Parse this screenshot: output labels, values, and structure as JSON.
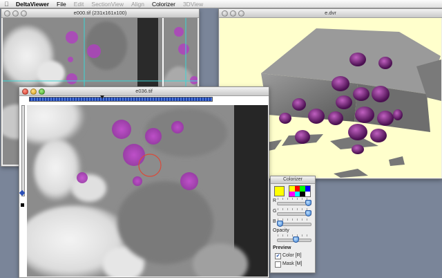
{
  "menubar": {
    "app": "DeltaViewer",
    "items": [
      "File",
      "Edit",
      "SectionView",
      "Align",
      "Colorizer",
      "3DView"
    ]
  },
  "windows": {
    "slice_view_1": {
      "title": "e000.tif (231x161x100)"
    },
    "volume_view": {
      "title": "e.dvr"
    },
    "slice_view_2": {
      "title": "e036.tif",
      "slice_position": 0.4
    },
    "colorizer": {
      "title": "Colorizer",
      "current_color": "#ffff00",
      "palette": [
        "#ffff00",
        "#ff0000",
        "#00ff00",
        "#0000ff",
        "#ff00ff",
        "#00ffff",
        "#000000",
        "#ffffff"
      ],
      "r_label": "R",
      "g_label": "G",
      "b_label": "B",
      "r_value": 1.0,
      "g_value": 1.0,
      "b_value": 0.0,
      "opacity_label": "Opacity",
      "opacity_value": 0.55,
      "preview_label": "Preview",
      "color_option": "Color [R]",
      "mask_option": "Mask [M]",
      "color_checked": true,
      "mask_checked": false
    }
  }
}
